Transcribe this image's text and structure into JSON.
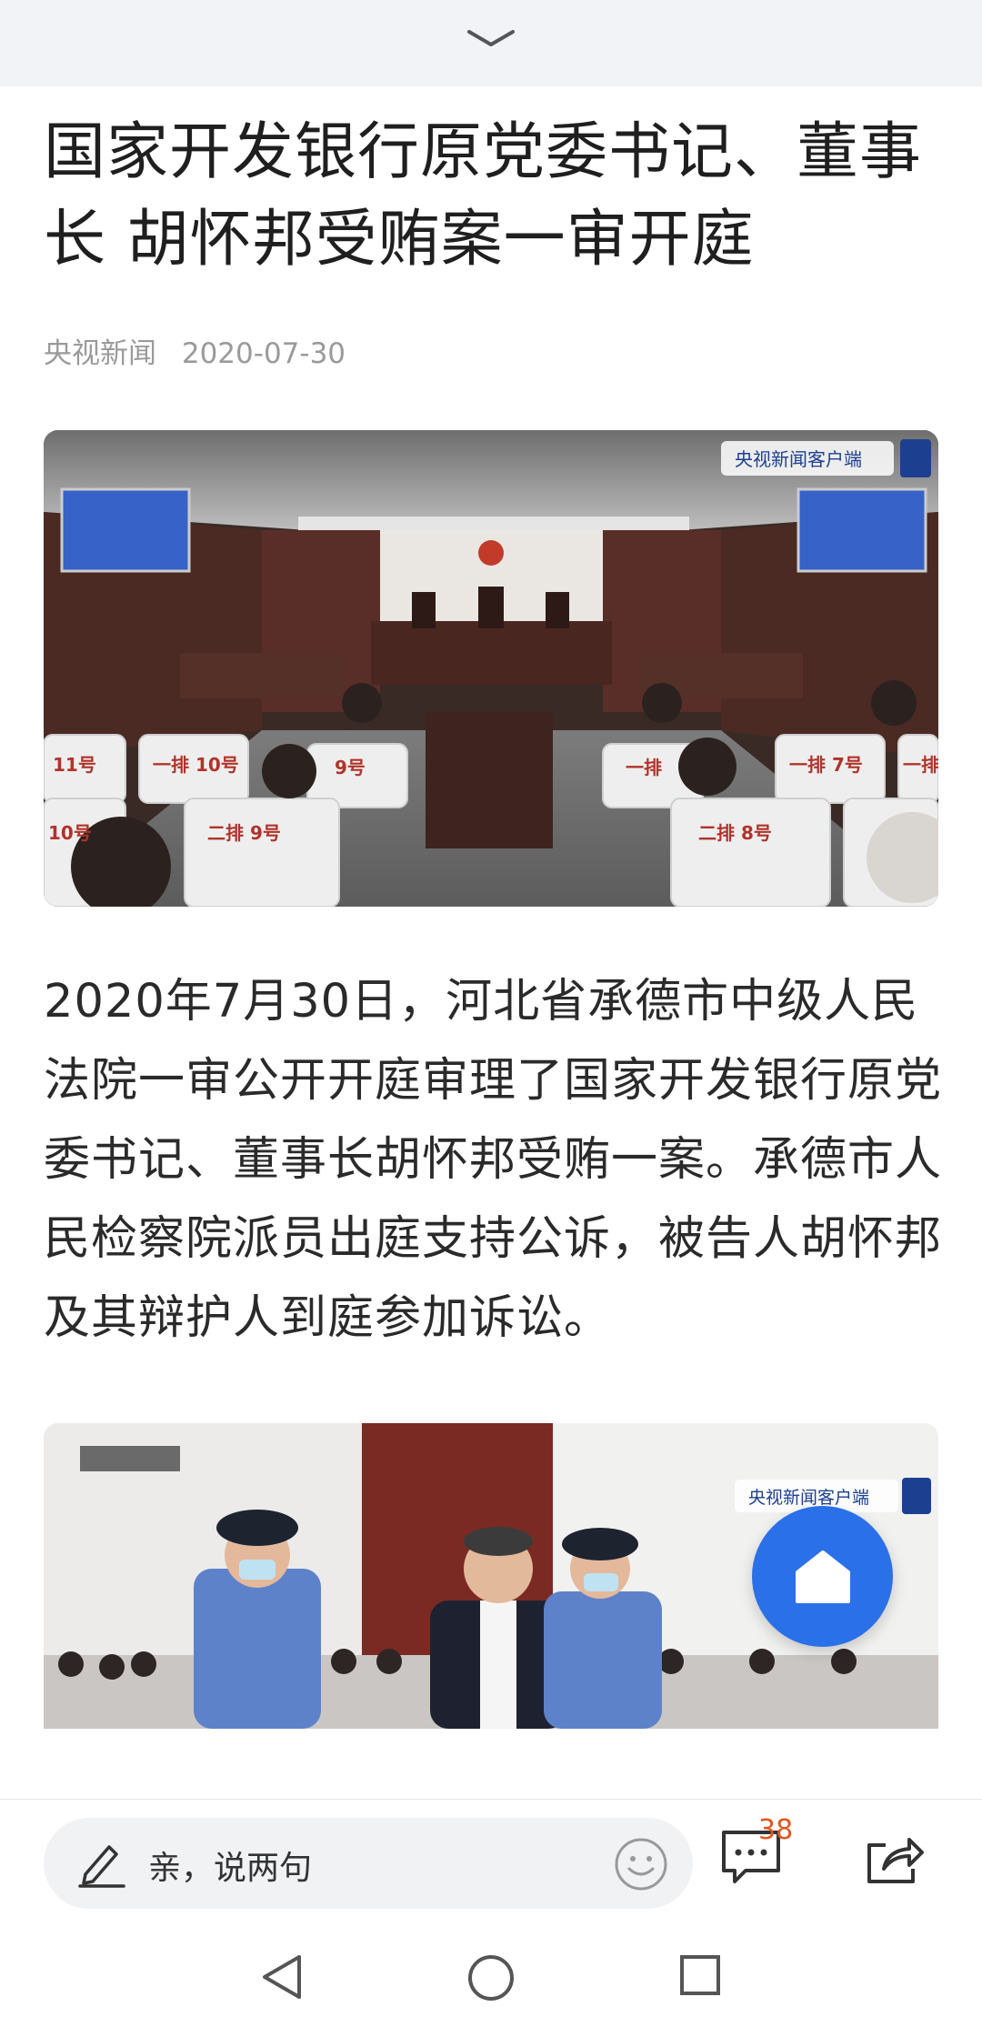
{
  "article": {
    "title": "国家开发银行原党委书记、董事长 胡怀邦受贿案一审开庭",
    "source": "央视新闻",
    "date": "2020-07-30",
    "body": "2020年7月30日，河北省承德市中级人民法院一审公开开庭审理了国家开发银行原党委书记、董事长胡怀邦受贿一案。承德市人民检察院派员出庭支持公诉，被告人胡怀邦及其辩护人到庭参加诉讼。"
  },
  "photo1": {
    "watermark": "央视新闻客户端",
    "seat_labels": [
      "11号",
      "一排 10号",
      "9号",
      "一排",
      "一排 7号",
      "一排",
      "10号",
      "二排 9号",
      "二排 8号"
    ]
  },
  "photo2": {
    "watermark": "央视新闻客户端"
  },
  "bottom_bar": {
    "comment_placeholder": "亲，说两句",
    "comment_count": "38"
  },
  "icons": {
    "collapse": "chevron-down-icon",
    "home": "home-icon",
    "pen": "pen-icon",
    "emoji": "emoji-icon",
    "comment": "comment-icon",
    "share": "share-icon",
    "back": "nav-back-icon",
    "home_nav": "nav-home-icon",
    "recents": "nav-recents-icon"
  },
  "colors": {
    "accent": "#2a70e8",
    "badge": "#e2551f"
  }
}
